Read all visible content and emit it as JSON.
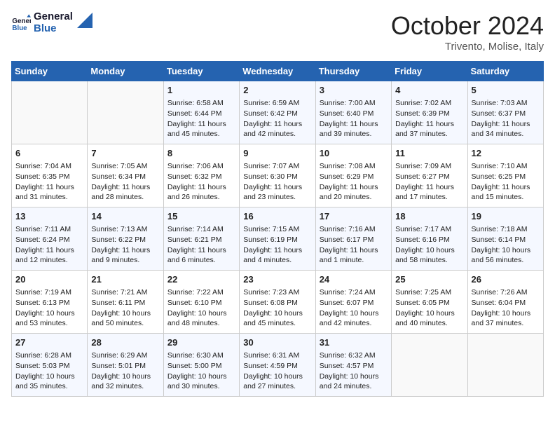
{
  "header": {
    "title": "October 2024",
    "location": "Trivento, Molise, Italy"
  },
  "weekdays": [
    "Sunday",
    "Monday",
    "Tuesday",
    "Wednesday",
    "Thursday",
    "Friday",
    "Saturday"
  ],
  "weeks": [
    [
      {
        "day": "",
        "info": ""
      },
      {
        "day": "",
        "info": ""
      },
      {
        "day": "1",
        "info": "Sunrise: 6:58 AM\nSunset: 6:44 PM\nDaylight: 11 hours and 45 minutes."
      },
      {
        "day": "2",
        "info": "Sunrise: 6:59 AM\nSunset: 6:42 PM\nDaylight: 11 hours and 42 minutes."
      },
      {
        "day": "3",
        "info": "Sunrise: 7:00 AM\nSunset: 6:40 PM\nDaylight: 11 hours and 39 minutes."
      },
      {
        "day": "4",
        "info": "Sunrise: 7:02 AM\nSunset: 6:39 PM\nDaylight: 11 hours and 37 minutes."
      },
      {
        "day": "5",
        "info": "Sunrise: 7:03 AM\nSunset: 6:37 PM\nDaylight: 11 hours and 34 minutes."
      }
    ],
    [
      {
        "day": "6",
        "info": "Sunrise: 7:04 AM\nSunset: 6:35 PM\nDaylight: 11 hours and 31 minutes."
      },
      {
        "day": "7",
        "info": "Sunrise: 7:05 AM\nSunset: 6:34 PM\nDaylight: 11 hours and 28 minutes."
      },
      {
        "day": "8",
        "info": "Sunrise: 7:06 AM\nSunset: 6:32 PM\nDaylight: 11 hours and 26 minutes."
      },
      {
        "day": "9",
        "info": "Sunrise: 7:07 AM\nSunset: 6:30 PM\nDaylight: 11 hours and 23 minutes."
      },
      {
        "day": "10",
        "info": "Sunrise: 7:08 AM\nSunset: 6:29 PM\nDaylight: 11 hours and 20 minutes."
      },
      {
        "day": "11",
        "info": "Sunrise: 7:09 AM\nSunset: 6:27 PM\nDaylight: 11 hours and 17 minutes."
      },
      {
        "day": "12",
        "info": "Sunrise: 7:10 AM\nSunset: 6:25 PM\nDaylight: 11 hours and 15 minutes."
      }
    ],
    [
      {
        "day": "13",
        "info": "Sunrise: 7:11 AM\nSunset: 6:24 PM\nDaylight: 11 hours and 12 minutes."
      },
      {
        "day": "14",
        "info": "Sunrise: 7:13 AM\nSunset: 6:22 PM\nDaylight: 11 hours and 9 minutes."
      },
      {
        "day": "15",
        "info": "Sunrise: 7:14 AM\nSunset: 6:21 PM\nDaylight: 11 hours and 6 minutes."
      },
      {
        "day": "16",
        "info": "Sunrise: 7:15 AM\nSunset: 6:19 PM\nDaylight: 11 hours and 4 minutes."
      },
      {
        "day": "17",
        "info": "Sunrise: 7:16 AM\nSunset: 6:17 PM\nDaylight: 11 hours and 1 minute."
      },
      {
        "day": "18",
        "info": "Sunrise: 7:17 AM\nSunset: 6:16 PM\nDaylight: 10 hours and 58 minutes."
      },
      {
        "day": "19",
        "info": "Sunrise: 7:18 AM\nSunset: 6:14 PM\nDaylight: 10 hours and 56 minutes."
      }
    ],
    [
      {
        "day": "20",
        "info": "Sunrise: 7:19 AM\nSunset: 6:13 PM\nDaylight: 10 hours and 53 minutes."
      },
      {
        "day": "21",
        "info": "Sunrise: 7:21 AM\nSunset: 6:11 PM\nDaylight: 10 hours and 50 minutes."
      },
      {
        "day": "22",
        "info": "Sunrise: 7:22 AM\nSunset: 6:10 PM\nDaylight: 10 hours and 48 minutes."
      },
      {
        "day": "23",
        "info": "Sunrise: 7:23 AM\nSunset: 6:08 PM\nDaylight: 10 hours and 45 minutes."
      },
      {
        "day": "24",
        "info": "Sunrise: 7:24 AM\nSunset: 6:07 PM\nDaylight: 10 hours and 42 minutes."
      },
      {
        "day": "25",
        "info": "Sunrise: 7:25 AM\nSunset: 6:05 PM\nDaylight: 10 hours and 40 minutes."
      },
      {
        "day": "26",
        "info": "Sunrise: 7:26 AM\nSunset: 6:04 PM\nDaylight: 10 hours and 37 minutes."
      }
    ],
    [
      {
        "day": "27",
        "info": "Sunrise: 6:28 AM\nSunset: 5:03 PM\nDaylight: 10 hours and 35 minutes."
      },
      {
        "day": "28",
        "info": "Sunrise: 6:29 AM\nSunset: 5:01 PM\nDaylight: 10 hours and 32 minutes."
      },
      {
        "day": "29",
        "info": "Sunrise: 6:30 AM\nSunset: 5:00 PM\nDaylight: 10 hours and 30 minutes."
      },
      {
        "day": "30",
        "info": "Sunrise: 6:31 AM\nSunset: 4:59 PM\nDaylight: 10 hours and 27 minutes."
      },
      {
        "day": "31",
        "info": "Sunrise: 6:32 AM\nSunset: 4:57 PM\nDaylight: 10 hours and 24 minutes."
      },
      {
        "day": "",
        "info": ""
      },
      {
        "day": "",
        "info": ""
      }
    ]
  ]
}
